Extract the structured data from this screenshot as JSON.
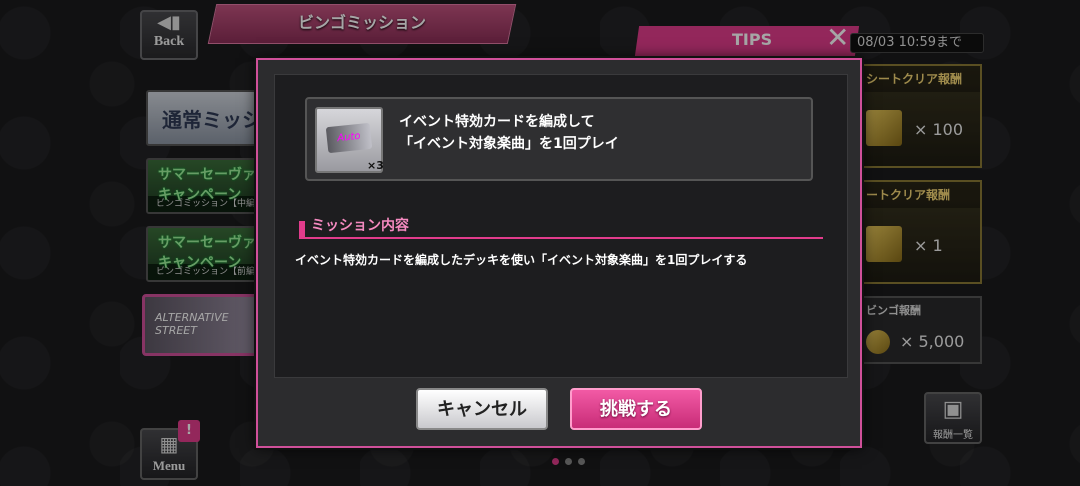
{
  "header": {
    "back_label": "Back",
    "title": "ビンゴミッション",
    "tips_label": "TIPS",
    "deadline": "08/03 10:59まで"
  },
  "mission_list": [
    {
      "label": "通常ミッシ"
    },
    {
      "label": "サマーセーヴァ キャンペーン",
      "sub": "ビンゴミッション【中編】"
    },
    {
      "label": "サマーセーヴァ キャンペーン",
      "sub": "ビンゴミッション【前編】"
    },
    {
      "label": "ALTERNATIVE STREET"
    }
  ],
  "rewards": [
    {
      "title": "シートクリア報酬",
      "count": "× 100"
    },
    {
      "title": "ートクリア報酬",
      "count": "× 1"
    },
    {
      "title": "ビンゴ報酬",
      "count": "× 5,000"
    }
  ],
  "bottom": {
    "menu_label": "Menu",
    "menu_badge": "!",
    "reward_list_label": "報酬一覧"
  },
  "modal": {
    "card": {
      "icon_text": "Auto",
      "quantity": "×3",
      "line1": "イベント特効カードを編成して",
      "line2": "「イベント対象楽曲」を1回プレイ"
    },
    "section_title": "ミッション内容",
    "description": "イベント特効カードを編成したデッキを使い「イベント対象楽曲」を1回プレイする",
    "cancel_label": "キャンセル",
    "challenge_label": "挑戦する"
  },
  "colors": {
    "accent": "#e23c8c",
    "modal_bg": "#2c2c2e"
  }
}
